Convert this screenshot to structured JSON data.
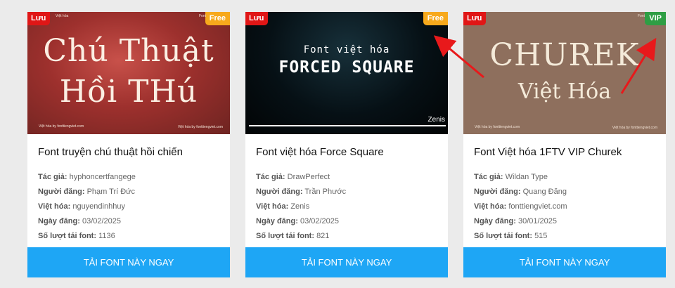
{
  "cards": [
    {
      "save_badge": "Lưu",
      "tier_badge": "Free",
      "thumb_tiny_tl": "Việt hóa",
      "thumb_tiny_tr": "Font",
      "thumb_tiny_bl": "Việt hóa by fonttiengviet.com",
      "thumb_tiny_br": "Việt hóa by fonttiengviet.com",
      "art_line1": "Chú Thuật",
      "art_line2": "Hồi THú",
      "title": "Font truyện chú thuật hồi chiến",
      "author_label": "Tác giả:",
      "author": "hyphoncertfangege",
      "poster_label": "Người đăng:",
      "poster": "Phạm Trí Đức",
      "viet_label": "Việt hóa:",
      "viet": "nguyendinhhuy",
      "date_label": "Ngày đăng:",
      "date": "03/02/2025",
      "downloads_label": "Số lượt tải font:",
      "downloads": "1136",
      "button": "TẢI FONT NÀY NGAY"
    },
    {
      "save_badge": "Lưu",
      "tier_badge": "Free",
      "art_line1": "Font việt hóa",
      "art_line2": "FORCED SQUARE",
      "art_sig": "Zenis",
      "title": "Font việt hóa Force Square",
      "author_label": "Tác giả:",
      "author": "DrawPerfect",
      "poster_label": "Người đăng:",
      "poster": "Trần Phước",
      "viet_label": "Việt hóa:",
      "viet": "Zenis",
      "date_label": "Ngày đăng:",
      "date": "03/02/2025",
      "downloads_label": "Số lượt tải font:",
      "downloads": "821",
      "button": "TẢI FONT NÀY NGAY"
    },
    {
      "save_badge": "Lưu",
      "tier_badge": "VIP",
      "thumb_tiny_tr": "Font",
      "thumb_tiny_bl": "Việt hóa by fonttiengviet.com",
      "thumb_tiny_br": "Việt hóa by fonttiengviet.com",
      "art_line1": "CHUREK",
      "art_line2": "Việt Hóa",
      "title": "Font Việt hóa 1FTV VIP Churek",
      "author_label": "Tác giả:",
      "author": "Wildan Type",
      "poster_label": "Người đăng:",
      "poster": "Quang Đăng",
      "viet_label": "Việt hóa:",
      "viet": "fonttiengviet.com",
      "date_label": "Ngày đăng:",
      "date": "30/01/2025",
      "downloads_label": "Số lượt tải font:",
      "downloads": "515",
      "button": "TẢI FONT NÀY NGAY"
    }
  ],
  "colors": {
    "save_badge": "#e01616",
    "free_badge": "#f7a91c",
    "vip_badge": "#2f9e44",
    "download_button": "#1ea6f5",
    "annotation_arrow": "#e8191b"
  }
}
